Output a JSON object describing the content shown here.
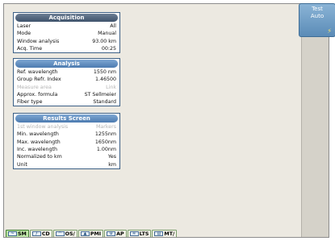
{
  "colors": {
    "panel_border": "#3b5f85",
    "accent_blue": "#4d7bb0",
    "background": "#ece9e1",
    "task_active": "#bfe6a8"
  },
  "test_auto": {
    "line1": "Test",
    "line2": "Auto",
    "icon": "bolt-icon"
  },
  "acquisition": {
    "title": "Acquisition",
    "rows": [
      {
        "label": "Laser",
        "value": "All"
      },
      {
        "label": "Mode",
        "value": "Manual"
      },
      {
        "label": "Window analysis",
        "value": "93.00 km"
      },
      {
        "label": "Acq. Time",
        "value": "00:25"
      }
    ]
  },
  "analysis": {
    "title": "Analysis",
    "rows": [
      {
        "label": "Ref. wavelength",
        "value": "1550 nm"
      },
      {
        "label": "Group Refr. Index",
        "value": "1.46500"
      },
      {
        "label": "Measure area",
        "value": "Link"
      },
      {
        "label": "Approx. formula",
        "value": "ST Sellmeier"
      },
      {
        "label": "Fiber type",
        "value": "Standard"
      }
    ]
  },
  "results": {
    "title": "Results Screen",
    "rows": [
      {
        "label": "1st window analysis",
        "value": "Markers"
      },
      {
        "label": "Min. wavelength",
        "value": "1255nm"
      },
      {
        "label": "Max. wavelength",
        "value": "1650nm"
      },
      {
        "label": "Inc. wavelength",
        "value": "1.00nm"
      },
      {
        "label": "Normalized to km",
        "value": "Yes"
      },
      {
        "label": "Unit",
        "value": "km"
      }
    ]
  },
  "taskbar": [
    {
      "label": "SM",
      "icon": "otdr-trace-icon"
    },
    {
      "label": "CD",
      "icon": "cd-icon"
    },
    {
      "label": "OS/",
      "icon": "spectrum-icon"
    },
    {
      "label": "PMI",
      "icon": "pmd-icon"
    },
    {
      "label": "AP",
      "icon": "ap-icon"
    },
    {
      "label": "LTS",
      "icon": "lts-icon"
    },
    {
      "label": "MT/",
      "icon": "mta-icon"
    }
  ]
}
